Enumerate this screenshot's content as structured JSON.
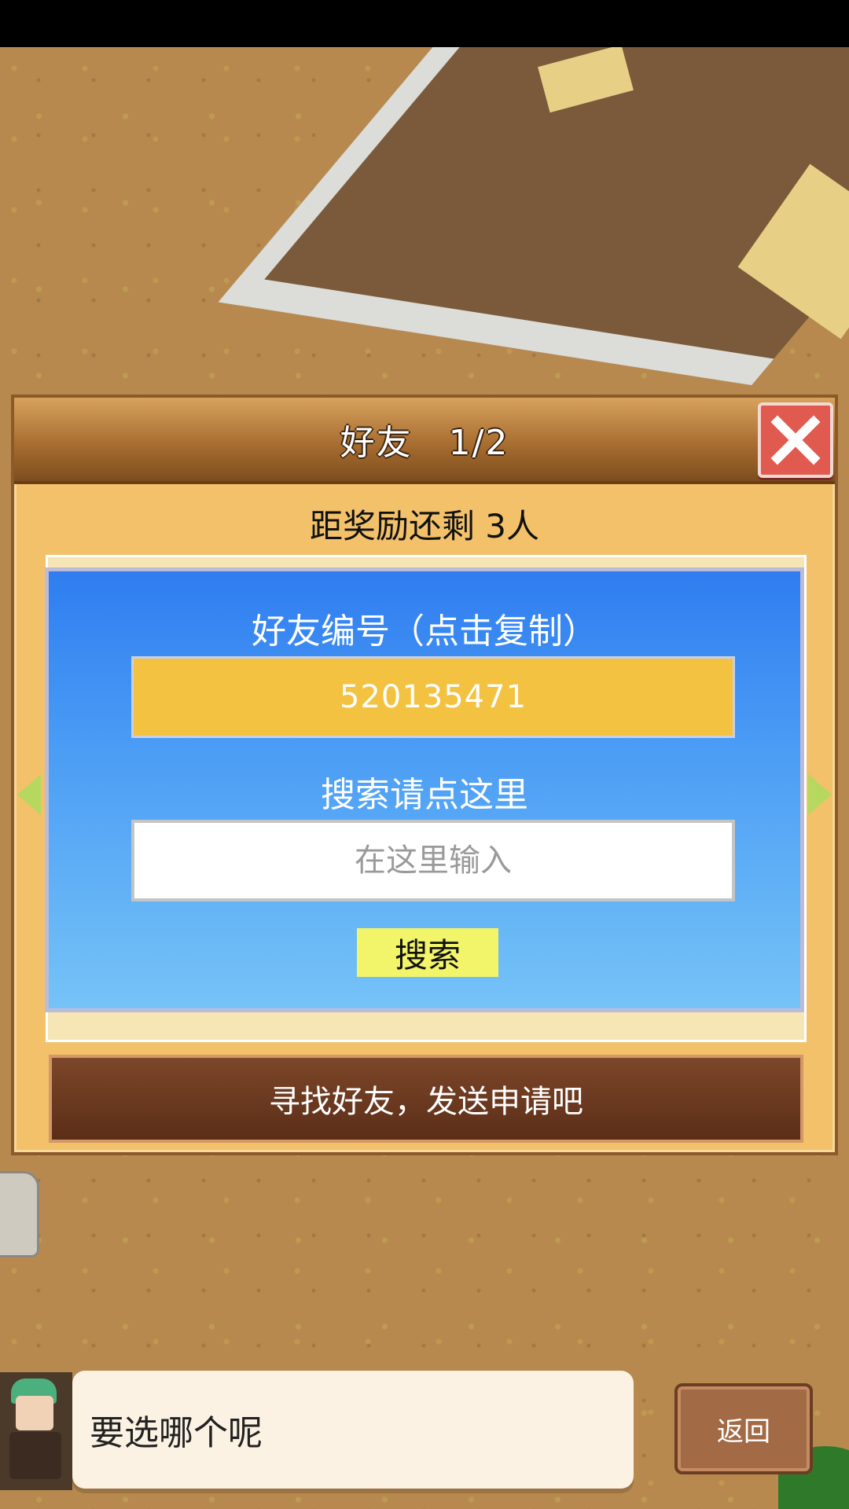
{
  "dialog": {
    "title": "好友　1/2",
    "reward_text": "距奖励还剩 3人",
    "close_icon": "close-icon"
  },
  "friend_code": {
    "label": "好友编号（点击复制）",
    "value": "520135471"
  },
  "search": {
    "label": "搜索请点这里",
    "placeholder": "在这里输入",
    "button_label": "搜索"
  },
  "find_friends_button": "寻找好友，发送申请吧",
  "bottom_bar": {
    "prompt": "要选哪个呢",
    "return_label": "返回"
  },
  "colors": {
    "panel": "#f2c16a",
    "dialog_blue": "#2f7df0",
    "code_box": "#f4c241",
    "search_button": "#f2f469",
    "close_button": "#e05a4f",
    "find_button": "#5b2e17"
  }
}
